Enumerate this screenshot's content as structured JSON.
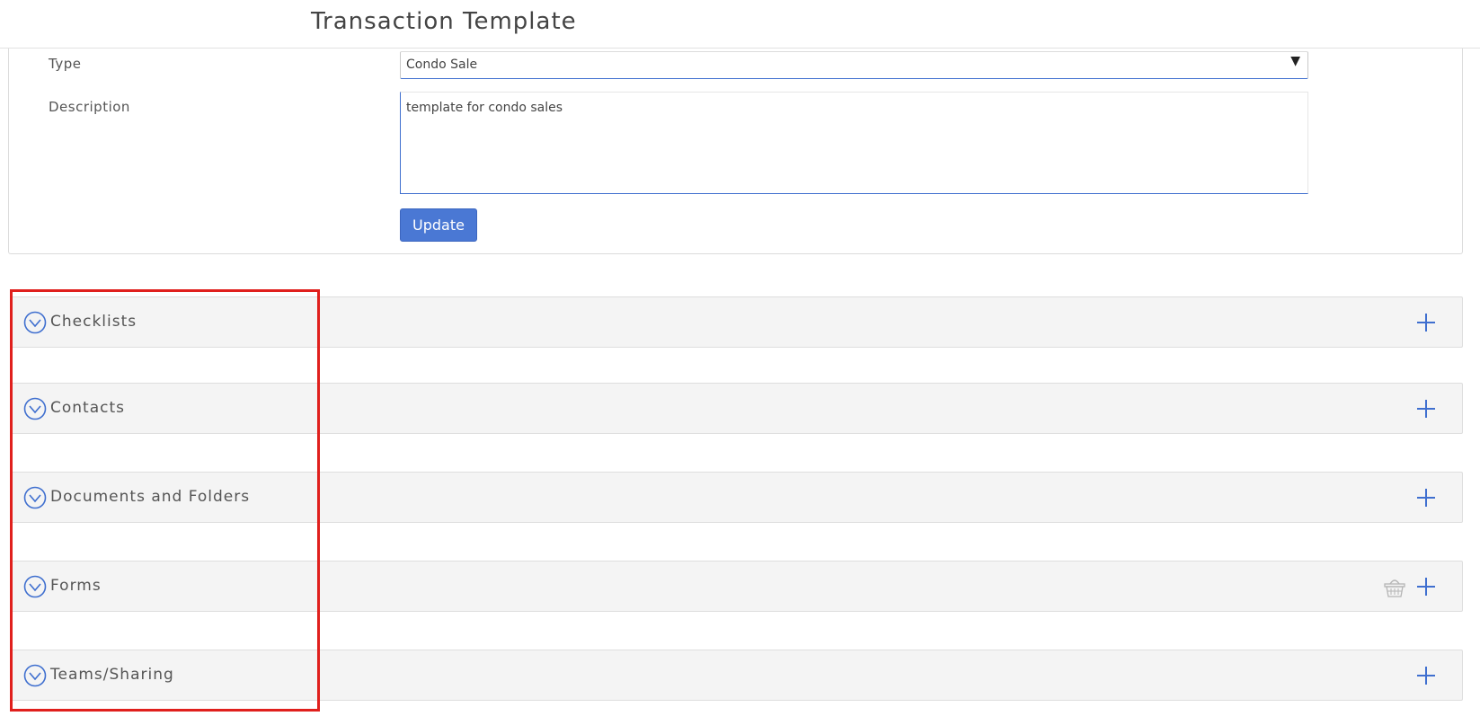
{
  "header": {
    "title": "Transaction Template"
  },
  "form": {
    "type_label": "Type",
    "type_value": "Condo Sale",
    "description_label": "Description",
    "description_value": "template for condo sales",
    "update_label": "Update"
  },
  "sections": [
    {
      "title": "Checklists",
      "toggle_icon": "chevron-down-circle-icon",
      "add_icon": "plus-icon"
    },
    {
      "title": "Contacts",
      "toggle_icon": "chevron-down-circle-icon",
      "add_icon": "plus-icon"
    },
    {
      "title": "Documents and Folders",
      "toggle_icon": "chevron-down-circle-icon",
      "add_icon": "plus-icon"
    },
    {
      "title": "Forms",
      "toggle_icon": "chevron-down-circle-icon",
      "add_icon": "plus-icon",
      "extra_icon": "basket-icon"
    },
    {
      "title": "Teams/Sharing",
      "toggle_icon": "chevron-down-circle-icon",
      "add_icon": "plus-icon"
    }
  ],
  "colors": {
    "accent": "#4a78d4",
    "highlight": "#e0201d",
    "section_bg": "#f4f4f4"
  }
}
